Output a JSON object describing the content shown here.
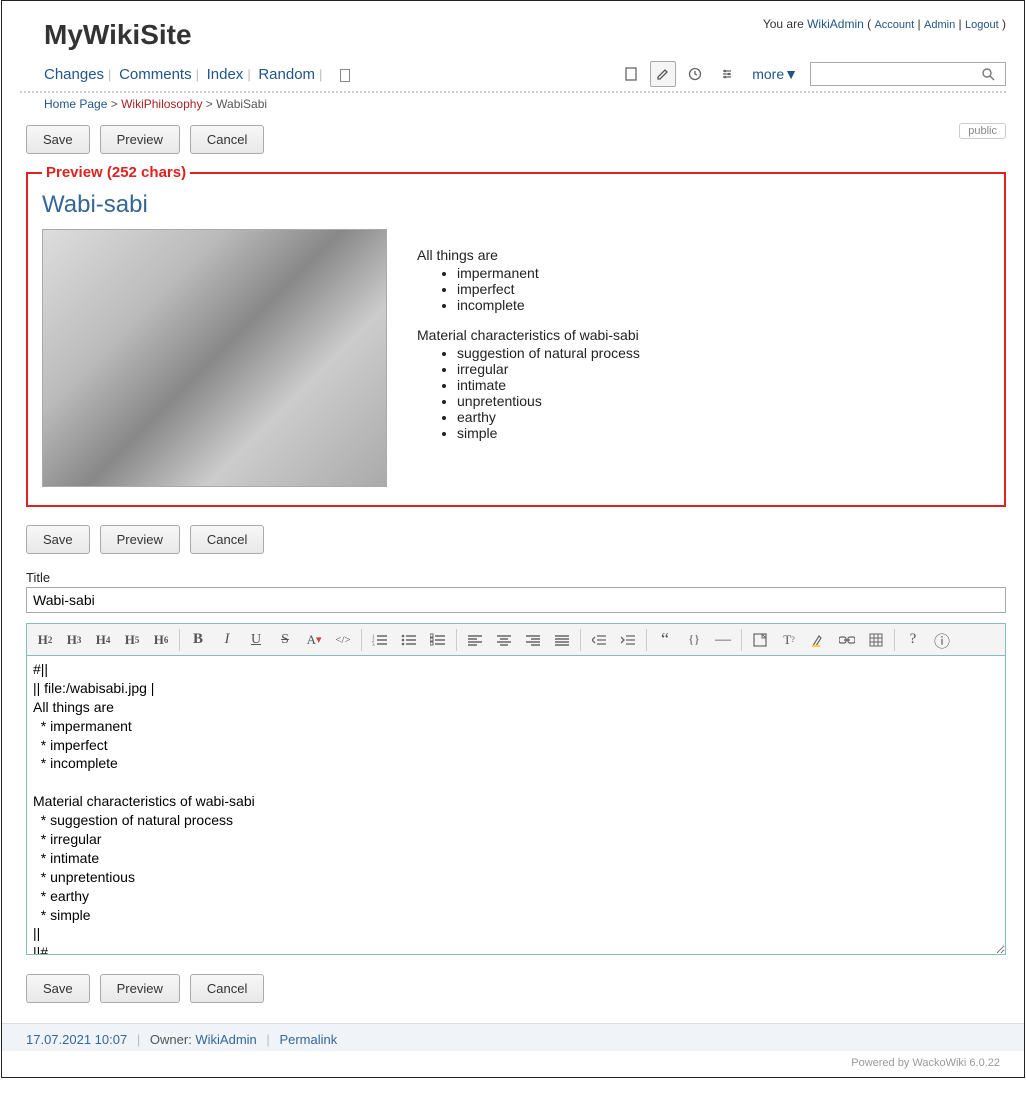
{
  "site": {
    "title": "MyWikiSite"
  },
  "user": {
    "prefix": "You are",
    "name": "WikiAdmin",
    "links": {
      "account": "Account",
      "admin": "Admin",
      "logout": "Logout"
    }
  },
  "nav": {
    "changes": "Changes",
    "comments": "Comments",
    "index": "Index",
    "random": "Random",
    "more": "more▼"
  },
  "breadcrumb": {
    "home": "Home Page",
    "parent": "WikiPhilosophy",
    "current": "WabiSabi",
    "sep": ">"
  },
  "buttons": {
    "save": "Save",
    "preview": "Preview",
    "cancel": "Cancel",
    "public": "public"
  },
  "preview": {
    "legend": "Preview (252 chars)",
    "heading": "Wabi-sabi",
    "p1": "All things are",
    "list1": [
      "impermanent",
      "imperfect",
      "incomplete"
    ],
    "p2": "Material characteristics of wabi-sabi",
    "list2": [
      "suggestion of natural process",
      "irregular",
      "intimate",
      "unpretentious",
      "earthy",
      "simple"
    ]
  },
  "title_field": {
    "label": "Title",
    "value": "Wabi-sabi"
  },
  "editor_content": "#||\n|| file:/wabisabi.jpg |\nAll things are\n  * impermanent\n  * imperfect\n  * incomplete\n\nMaterial characteristics of wabi-sabi\n  * suggestion of natural process\n  * irregular\n  * intimate\n  * unpretentious\n  * earthy\n  * simple\n||\n||#",
  "footer": {
    "timestamp": "17.07.2021 10:07",
    "owner_label": "Owner:",
    "owner": "WikiAdmin",
    "permalink": "Permalink",
    "powered": "Powered by WackoWiki 6.0.22"
  },
  "toolbar": {
    "h2": "H2",
    "h3": "H3",
    "h4": "H4",
    "h5": "H5",
    "h6": "H6",
    "bold": "B",
    "italic": "I",
    "underline": "U",
    "strike": "S",
    "textcolor": "A",
    "code": "</>",
    "quote": "“",
    "braces": "{}",
    "hr": "—",
    "questionmark": "?",
    "info": "ⓘ"
  }
}
